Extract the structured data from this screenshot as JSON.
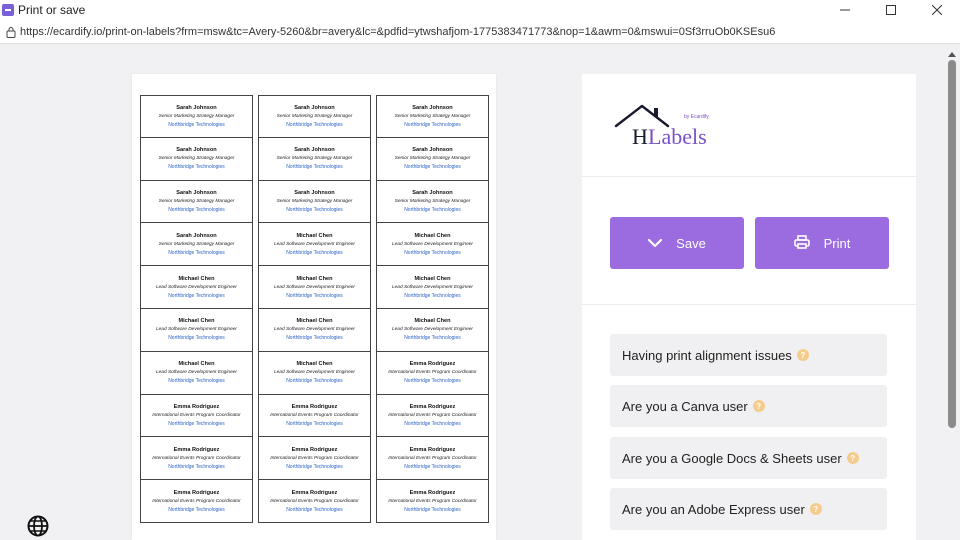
{
  "window": {
    "title": "Print or save",
    "minimize_icon": "minimize-icon",
    "maximize_icon": "maximize-icon",
    "close_icon": "close-icon"
  },
  "address": {
    "url": "https://ecardify.io/print-on-labels?frm=msw&tc=Avery-5260&br=avery&lc=&pdfid=ytwshafjom-1775383471773&nop=1&awm=0&mswui=0Sf3rruOb0KSEsu6"
  },
  "sheet": {
    "labels": [
      {
        "name": "Sarah Johnson",
        "title": "Senior Marketing Strategy Manager",
        "company": "Northbridge Technologies"
      },
      {
        "name": "Sarah Johnson",
        "title": "Senior Marketing Strategy Manager",
        "company": "Northbridge Technologies"
      },
      {
        "name": "Sarah Johnson",
        "title": "Senior Marketing Strategy Manager",
        "company": "Northbridge Technologies"
      },
      {
        "name": "Sarah Johnson",
        "title": "Senior Marketing Strategy Manager",
        "company": "Northbridge Technologies"
      },
      {
        "name": "Sarah Johnson",
        "title": "Senior Marketing Strategy Manager",
        "company": "Northbridge Technologies"
      },
      {
        "name": "Sarah Johnson",
        "title": "Senior Marketing Strategy Manager",
        "company": "Northbridge Technologies"
      },
      {
        "name": "Sarah Johnson",
        "title": "Senior Marketing Strategy Manager",
        "company": "Northbridge Technologies"
      },
      {
        "name": "Sarah Johnson",
        "title": "Senior Marketing Strategy Manager",
        "company": "Northbridge Technologies"
      },
      {
        "name": "Sarah Johnson",
        "title": "Senior Marketing Strategy Manager",
        "company": "Northbridge Technologies"
      },
      {
        "name": "Sarah Johnson",
        "title": "Senior Marketing Strategy Manager",
        "company": "Northbridge Technologies"
      },
      {
        "name": "Michael Chen",
        "title": "Lead Software Development Engineer",
        "company": "Northbridge Technologies"
      },
      {
        "name": "Michael Chen",
        "title": "Lead Software Development Engineer",
        "company": "Northbridge Technologies"
      },
      {
        "name": "Michael Chen",
        "title": "Lead Software Development Engineer",
        "company": "Northbridge Technologies"
      },
      {
        "name": "Michael Chen",
        "title": "Lead Software Development Engineer",
        "company": "Northbridge Technologies"
      },
      {
        "name": "Michael Chen",
        "title": "Lead Software Development Engineer",
        "company": "Northbridge Technologies"
      },
      {
        "name": "Michael Chen",
        "title": "Lead Software Development Engineer",
        "company": "Northbridge Technologies"
      },
      {
        "name": "Michael Chen",
        "title": "Lead Software Development Engineer",
        "company": "Northbridge Technologies"
      },
      {
        "name": "Michael Chen",
        "title": "Lead Software Development Engineer",
        "company": "Northbridge Technologies"
      },
      {
        "name": "Michael Chen",
        "title": "Lead Software Development Engineer",
        "company": "Northbridge Technologies"
      },
      {
        "name": "Michael Chen",
        "title": "Lead Software Development Engineer",
        "company": "Northbridge Technologies"
      },
      {
        "name": "Emma Rodriguez",
        "title": "International Events Program Coordinator",
        "company": "Northbridge Technologies"
      },
      {
        "name": "Emma Rodriguez",
        "title": "International Events Program Coordinator",
        "company": "Northbridge Technologies"
      },
      {
        "name": "Emma Rodriguez",
        "title": "International Events Program Coordinator",
        "company": "Northbridge Technologies"
      },
      {
        "name": "Emma Rodriguez",
        "title": "International Events Program Coordinator",
        "company": "Northbridge Technologies"
      },
      {
        "name": "Emma Rodriguez",
        "title": "International Events Program Coordinator",
        "company": "Northbridge Technologies"
      },
      {
        "name": "Emma Rodriguez",
        "title": "International Events Program Coordinator",
        "company": "Northbridge Technologies"
      },
      {
        "name": "Emma Rodriguez",
        "title": "International Events Program Coordinator",
        "company": "Northbridge Technologies"
      },
      {
        "name": "Emma Rodriguez",
        "title": "International Events Program Coordinator",
        "company": "Northbridge Technologies"
      },
      {
        "name": "Emma Rodriguez",
        "title": "International Events Program Coordinator",
        "company": "Northbridge Technologies"
      },
      {
        "name": "Emma Rodriguez",
        "title": "International Events Program Coordinator",
        "company": "Northbridge Technologies"
      }
    ]
  },
  "panel": {
    "logo": {
      "brand": "HLabels",
      "byline": "by Ecardify"
    },
    "save_label": "Save",
    "save_icon": "chevron-down-icon",
    "print_label": "Print",
    "print_icon": "printer-icon",
    "accent_color": "#9b6be0",
    "faq": [
      {
        "label": "Having print alignment issues",
        "icon": "question-icon"
      },
      {
        "label": "Are you a Canva user",
        "icon": "question-icon"
      },
      {
        "label": "Are you a Google Docs & Sheets user",
        "icon": "question-icon"
      },
      {
        "label": "Are you an Adobe Express user",
        "icon": "question-icon"
      }
    ]
  },
  "footer": {
    "language_icon": "globe-icon"
  }
}
